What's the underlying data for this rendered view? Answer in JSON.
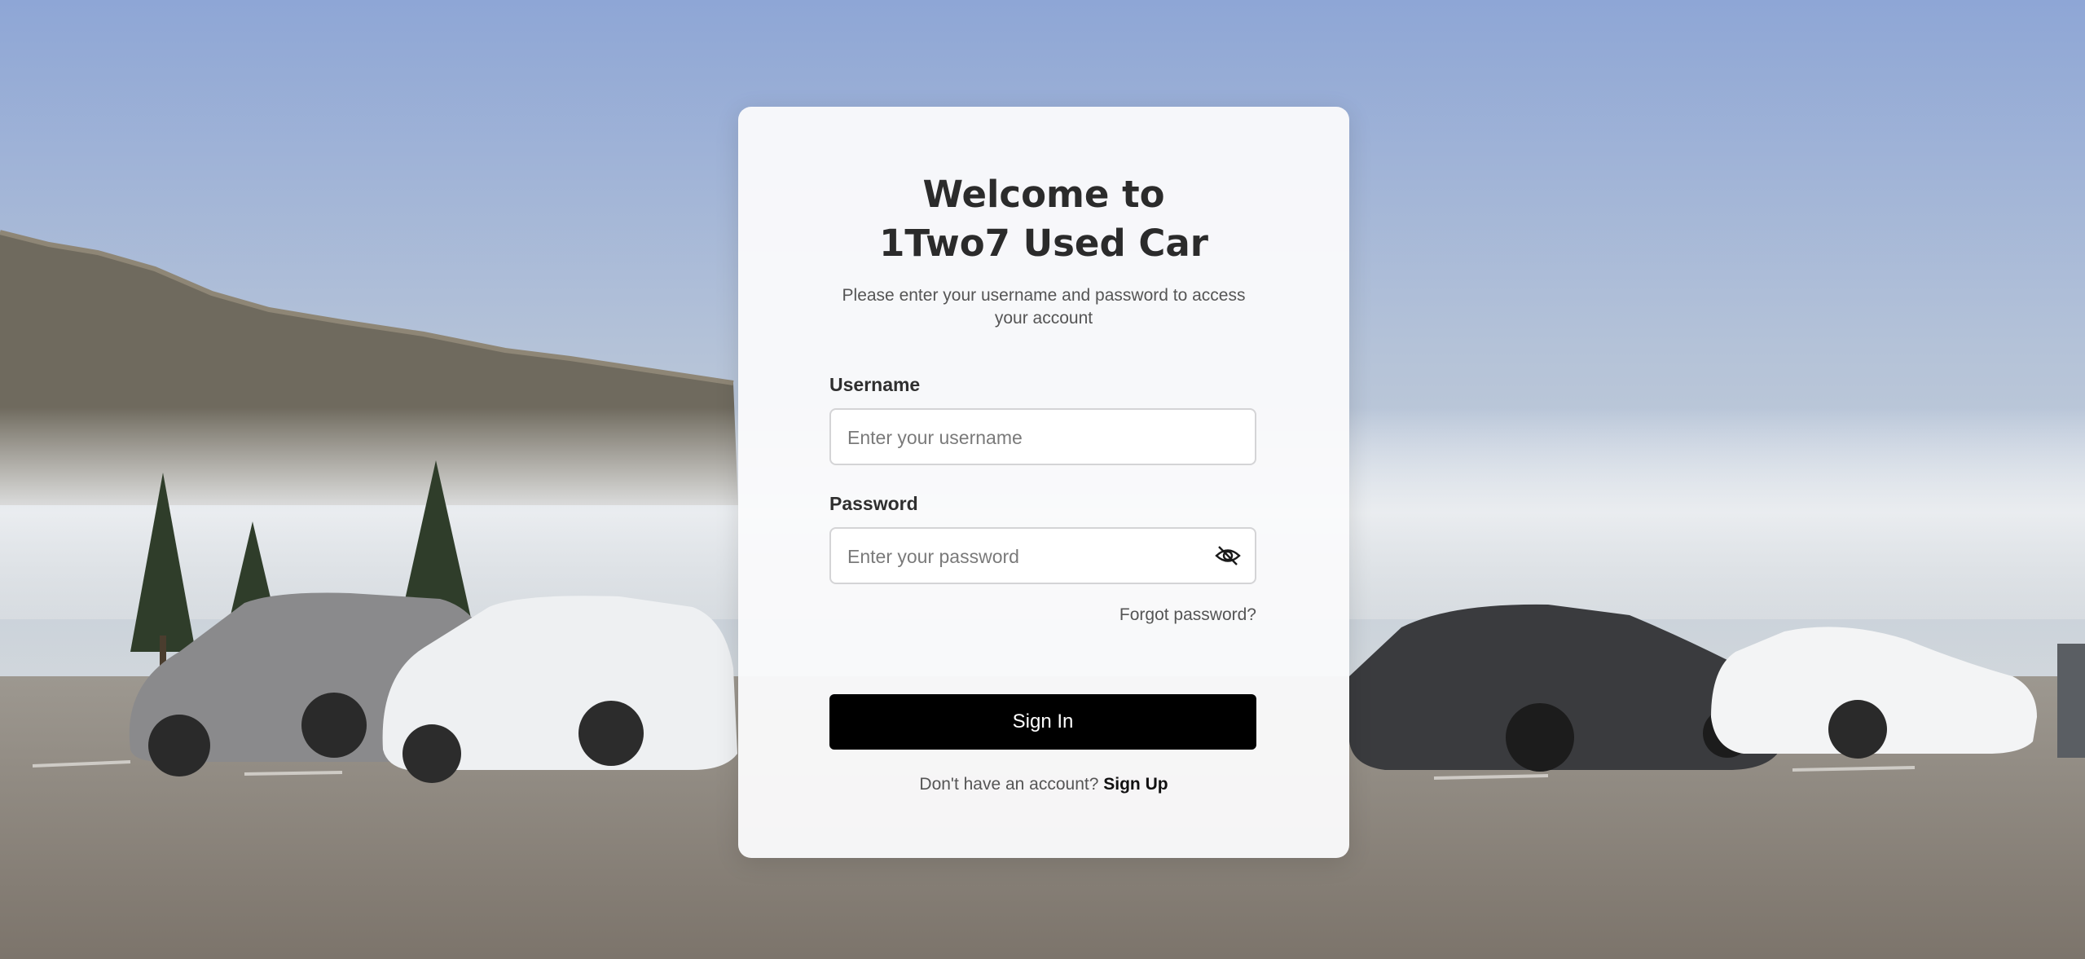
{
  "login": {
    "title_line1": "Welcome to",
    "title_line2": "1Two7 Used Car",
    "subtitle": "Please enter your username and password to access your account",
    "username_label": "Username",
    "username_placeholder": "Enter your username",
    "password_label": "Password",
    "password_placeholder": "Enter your password",
    "forgot_password": "Forgot password?",
    "sign_in": "Sign In",
    "no_account": "Don't have an account?",
    "sign_up": "Sign Up"
  },
  "icons": {
    "password_toggle": "eye-slash-icon"
  },
  "colors": {
    "primary_button": "#000000",
    "card_background": "#fafafb",
    "title_text": "#2b2b2b"
  }
}
